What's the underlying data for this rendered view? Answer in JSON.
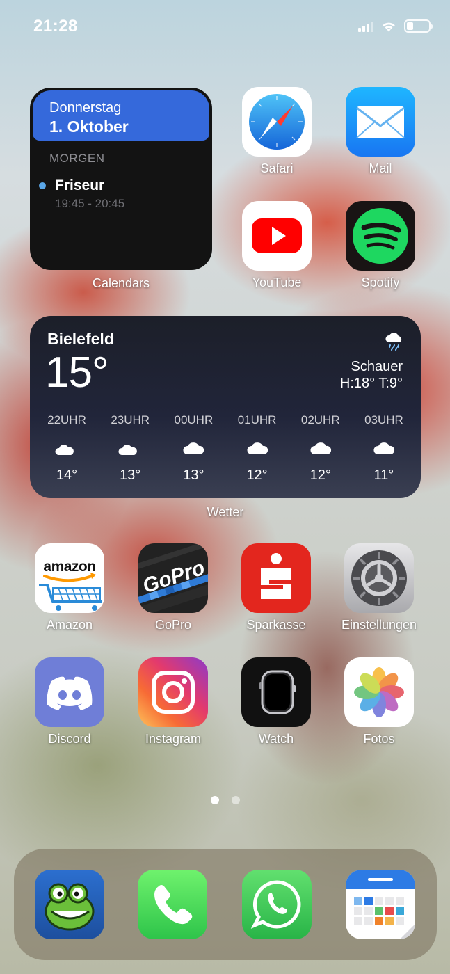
{
  "status_bar": {
    "time": "21:28",
    "battery_level": 0.3
  },
  "calendar_widget": {
    "day": "Donnerstag",
    "date": "1. Oktober",
    "section": "MORGEN",
    "event_title": "Friseur",
    "event_time": "19:45 - 20:45",
    "label": "Calendars",
    "accent_color": "#3569db"
  },
  "apps": {
    "safari": "Safari",
    "mail": "Mail",
    "youtube": "YouTube",
    "spotify": "Spotify",
    "amazon": "Amazon",
    "gopro": "GoPro",
    "sparkasse": "Sparkasse",
    "settings": "Einstellungen",
    "discord": "Discord",
    "instagram": "Instagram",
    "watch": "Watch",
    "photos": "Fotos"
  },
  "icon_text": {
    "amazon_logo": "amazon",
    "gopro_logo": "GoPro"
  },
  "weather_widget": {
    "city": "Bielefeld",
    "temperature": "15°",
    "condition": "Schauer",
    "high_low": "H:18° T:9°",
    "label": "Wetter",
    "condition_icon": "cloud-rain-icon",
    "hourly": [
      {
        "time": "22UHR",
        "icon": "cloud-moon-icon",
        "temp": "14°"
      },
      {
        "time": "23UHR",
        "icon": "cloud-moon-icon",
        "temp": "13°"
      },
      {
        "time": "00UHR",
        "icon": "cloud-icon",
        "temp": "13°"
      },
      {
        "time": "01UHR",
        "icon": "cloud-icon",
        "temp": "12°"
      },
      {
        "time": "02UHR",
        "icon": "cloud-icon",
        "temp": "12°"
      },
      {
        "time": "03UHR",
        "icon": "cloud-icon",
        "temp": "11°"
      }
    ]
  },
  "page_indicator": {
    "pages": 2,
    "current": 1
  },
  "dock": [
    "frog-game-icon",
    "phone-icon",
    "whatsapp-icon",
    "calendar-app-icon"
  ]
}
